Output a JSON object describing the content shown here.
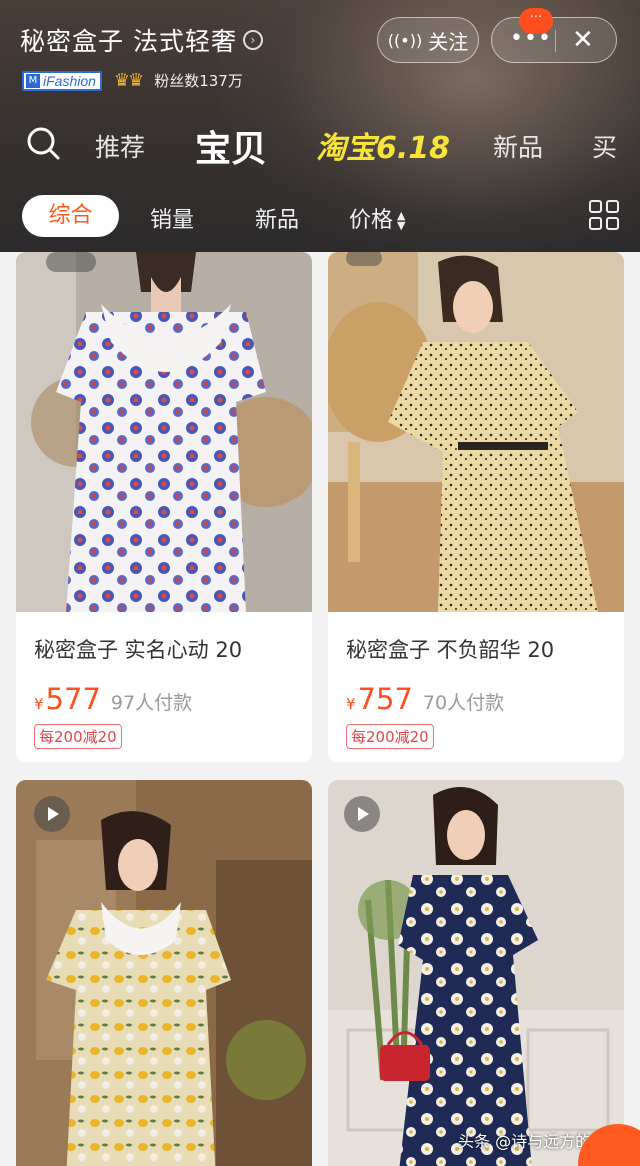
{
  "header": {
    "shop_name": "秘密盒子 法式轻奢",
    "brand_badge": "iFashion",
    "crowns": "♛♛",
    "fans": "粉丝数137万",
    "follow_label": "关注",
    "menu_dots": "•••",
    "close_glyph": "✕",
    "msg_badge": "···"
  },
  "nav": {
    "items": [
      "推荐",
      "宝贝",
      "淘宝6.18",
      "新品",
      "买"
    ],
    "active": "宝贝"
  },
  "filter": {
    "items": [
      "综合",
      "销量",
      "新品",
      "价格"
    ],
    "active": "综合",
    "price_sort_glyph": "▲▼"
  },
  "products": [
    {
      "title": "秘密盒子 实名心动 20",
      "currency": "¥",
      "price": "577",
      "sold": "97人付款",
      "coupon": "每200减20"
    },
    {
      "title": "秘密盒子 不负韶华 20",
      "currency": "¥",
      "price": "757",
      "sold": "70人付款",
      "coupon": "每200减20"
    }
  ],
  "watermark": "头条 @诗与远方的骗子",
  "colors": {
    "accent": "#ff4f1f",
    "promo_yellow": "#f7e33a",
    "coupon_red": "#e64545"
  },
  "icons": [
    "search-icon",
    "wifi-icon",
    "more-icon",
    "close-icon",
    "grid-view-icon",
    "play-icon",
    "chevron-right-icon",
    "cart-icon"
  ]
}
